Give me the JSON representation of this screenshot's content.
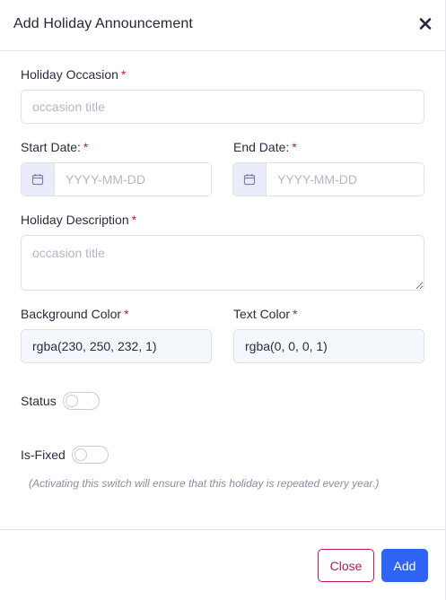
{
  "modal": {
    "title": "Add Holiday Announcement",
    "close_icon": "close-icon"
  },
  "form": {
    "occasion": {
      "label": "Holiday Occasion",
      "required": "*",
      "placeholder": "occasion title",
      "value": ""
    },
    "start_date": {
      "label": "Start Date:",
      "required": "*",
      "placeholder": "YYYY-MM-DD",
      "icon": "calendar-icon"
    },
    "end_date": {
      "label": "End Date:",
      "required": "*",
      "placeholder": "YYYY-MM-DD",
      "icon": "calendar-icon"
    },
    "description": {
      "label": "Holiday Description",
      "required": "*",
      "placeholder": "occasion title"
    },
    "background_color": {
      "label": "Background Color",
      "required": "*",
      "value": "rgba(230, 250, 232, 1)"
    },
    "text_color": {
      "label": "Text Color",
      "required": "*",
      "value": "rgba(0, 0, 0, 1)"
    },
    "status": {
      "label": "Status",
      "checked": false
    },
    "is_fixed": {
      "label": "Is-Fixed",
      "checked": false,
      "hint": "(Activating this switch will ensure that this holiday is repeated every year.)"
    }
  },
  "footer": {
    "close_label": "Close",
    "add_label": "Add"
  },
  "colors": {
    "required": "#d0124a",
    "primary": "#2f63f5",
    "danger": "#c3174e"
  }
}
